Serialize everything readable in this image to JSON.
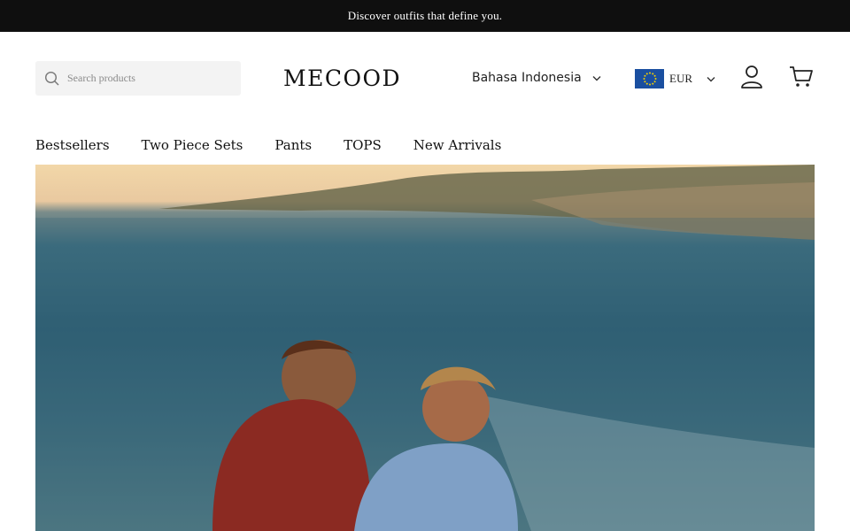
{
  "announcement": {
    "text": "Discover outfits that define you."
  },
  "header": {
    "search_placeholder": "Search products",
    "logo": "MECOOD",
    "language": "Bahasa Indonesia",
    "currency": "EUR"
  },
  "icons": {
    "search": "search-icon",
    "lang_chevron": "chevron-down-icon",
    "currency_chevron": "chevron-down-icon",
    "flag": "eu-flag-icon",
    "account": "user-icon",
    "cart": "cart-icon"
  },
  "nav": {
    "items": [
      {
        "label": "Bestsellers"
      },
      {
        "label": "Two Piece Sets"
      },
      {
        "label": "Pants"
      },
      {
        "label": "TOPS"
      },
      {
        "label": "New Arrivals"
      }
    ]
  },
  "colors": {
    "announcement_bg": "#0f0f0f",
    "search_bg": "#f3f3f3",
    "flag_blue": "#1a4fa0"
  }
}
